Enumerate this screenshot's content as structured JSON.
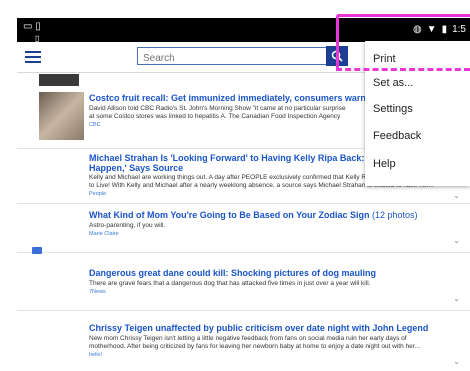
{
  "status_bar": {
    "time": "1:5"
  },
  "toolbar": {
    "search_placeholder": "Search"
  },
  "menu": {
    "items": [
      "Print",
      "Set as...",
      "Settings",
      "Feedback",
      "Help"
    ]
  },
  "articles": [
    {
      "title": "Costco fruit recall: Get immunized immediately, consumers warned",
      "desc": [
        "David Allison told CBC Radio's St. John's Morning Show \"it came at no particular surprise",
        "at some Costco stores was linked to hepatitis A. The Canadian Food Inspection Agency"
      ],
      "source": "CBC"
    },
    {
      "title": "Michael Strahan Is 'Looking Forward' to Having Kelly Ripa Back: 'He Never W",
      "title2": "Happen,' Says Source",
      "desc": [
        "Kelly and Michael are working things out. A day after PEOPLE exclusively confirmed that Kelly Ripa would be returning",
        "to Live! With Kelly and Michael after a nearly weeklong absence, a source says Michael Strahan is excited to have her..."
      ],
      "source": "People"
    },
    {
      "title": "What Kind of Mom You're Going to Be Based on Your Zodiac Sign",
      "badge": "(12 photos)",
      "desc": [
        "Astro-parenting, if you will."
      ],
      "source": "Marie Claire"
    },
    {
      "title": "Dangerous great dane could kill: Shocking pictures of dog mauling",
      "desc": [
        "There are grave fears that a dangerous dog that has attacked five times in just over a year will kill."
      ],
      "source": "7News"
    },
    {
      "title": "Chrissy Teigen unaffected by public criticism over date night with John Legend",
      "desc": [
        "New mom Chrissy Teigen isn't letting a little negative feedback from fans on social media ruin her early days of",
        "motherhood. After being criticized by fans for leaving her newborn baby at home to enjoy a date night out with her..."
      ],
      "source": "hello!"
    }
  ],
  "colors": {
    "accent": "#1c3f94",
    "title_link": "#1a55c7",
    "annotation": "#e837d6"
  }
}
